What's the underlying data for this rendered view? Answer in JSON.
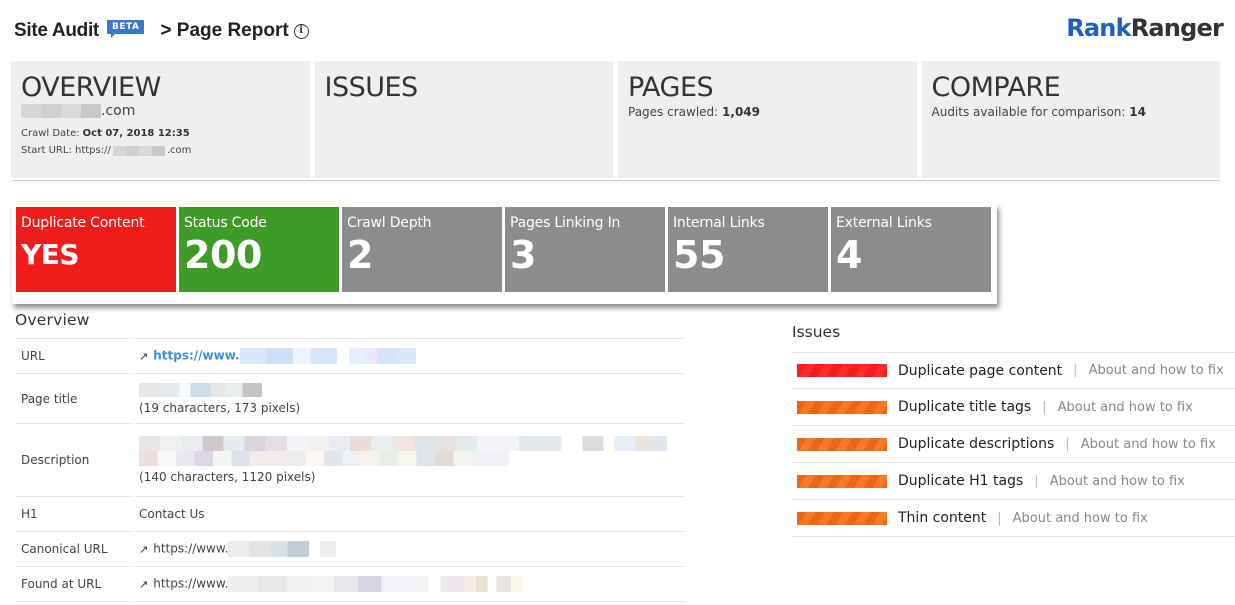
{
  "header": {
    "title": "Site Audit",
    "beta": "BETA",
    "crumb": "> Page Report",
    "info_icon": "i"
  },
  "logo": {
    "part1": "Rank",
    "part2": "Ranger"
  },
  "cards": {
    "overview": {
      "title": "OVERVIEW",
      "domain_suffix": ".com",
      "crawl_date_label": "Crawl Date:",
      "crawl_date": "Oct 07, 2018 12:35",
      "start_url_label": "Start URL: https://",
      "start_url_suffix": ".com"
    },
    "issues": {
      "title": "ISSUES"
    },
    "pages": {
      "title": "PAGES",
      "label": "Pages crawled:",
      "value": "1,049"
    },
    "compare": {
      "title": "COMPARE",
      "label": "Audits available for comparison:",
      "value": "14"
    }
  },
  "metrics": [
    {
      "label": "Duplicate Content",
      "value": "YES",
      "color": "#ef1c1c"
    },
    {
      "label": "Status Code",
      "value": "200",
      "color": "#3f9b27"
    },
    {
      "label": "Crawl Depth",
      "value": "2",
      "color": "#8c8c8c"
    },
    {
      "label": "Pages Linking In",
      "value": "3",
      "color": "#8c8c8c"
    },
    {
      "label": "Internal Links",
      "value": "55",
      "color": "#8c8c8c"
    },
    {
      "label": "External Links",
      "value": "4",
      "color": "#8c8c8c"
    }
  ],
  "overview": {
    "title": "Overview",
    "rows": [
      {
        "key": "URL",
        "value": "https://www."
      },
      {
        "key": "Page title",
        "detail": "(19 characters, 173 pixels)"
      },
      {
        "key": "Description",
        "detail": "(140 characters, 1120 pixels)"
      },
      {
        "key": "H1",
        "value": "Contact Us"
      },
      {
        "key": "Canonical URL",
        "value": "https://www."
      },
      {
        "key": "Found at URL",
        "value": "https://www."
      }
    ],
    "external_link_icon": "↗"
  },
  "issues": {
    "title": "Issues",
    "fix_label": "About and how to fix",
    "separator": "|",
    "items": [
      {
        "name": "Duplicate page content",
        "severity": "high",
        "color": "#f21d1d"
      },
      {
        "name": "Duplicate title tags",
        "severity": "medium",
        "color": "#ee6515"
      },
      {
        "name": "Duplicate descriptions",
        "severity": "medium",
        "color": "#ee6515"
      },
      {
        "name": "Duplicate H1 tags",
        "severity": "medium",
        "color": "#ee6515"
      },
      {
        "name": "Thin content",
        "severity": "medium",
        "color": "#ee6515"
      }
    ]
  }
}
